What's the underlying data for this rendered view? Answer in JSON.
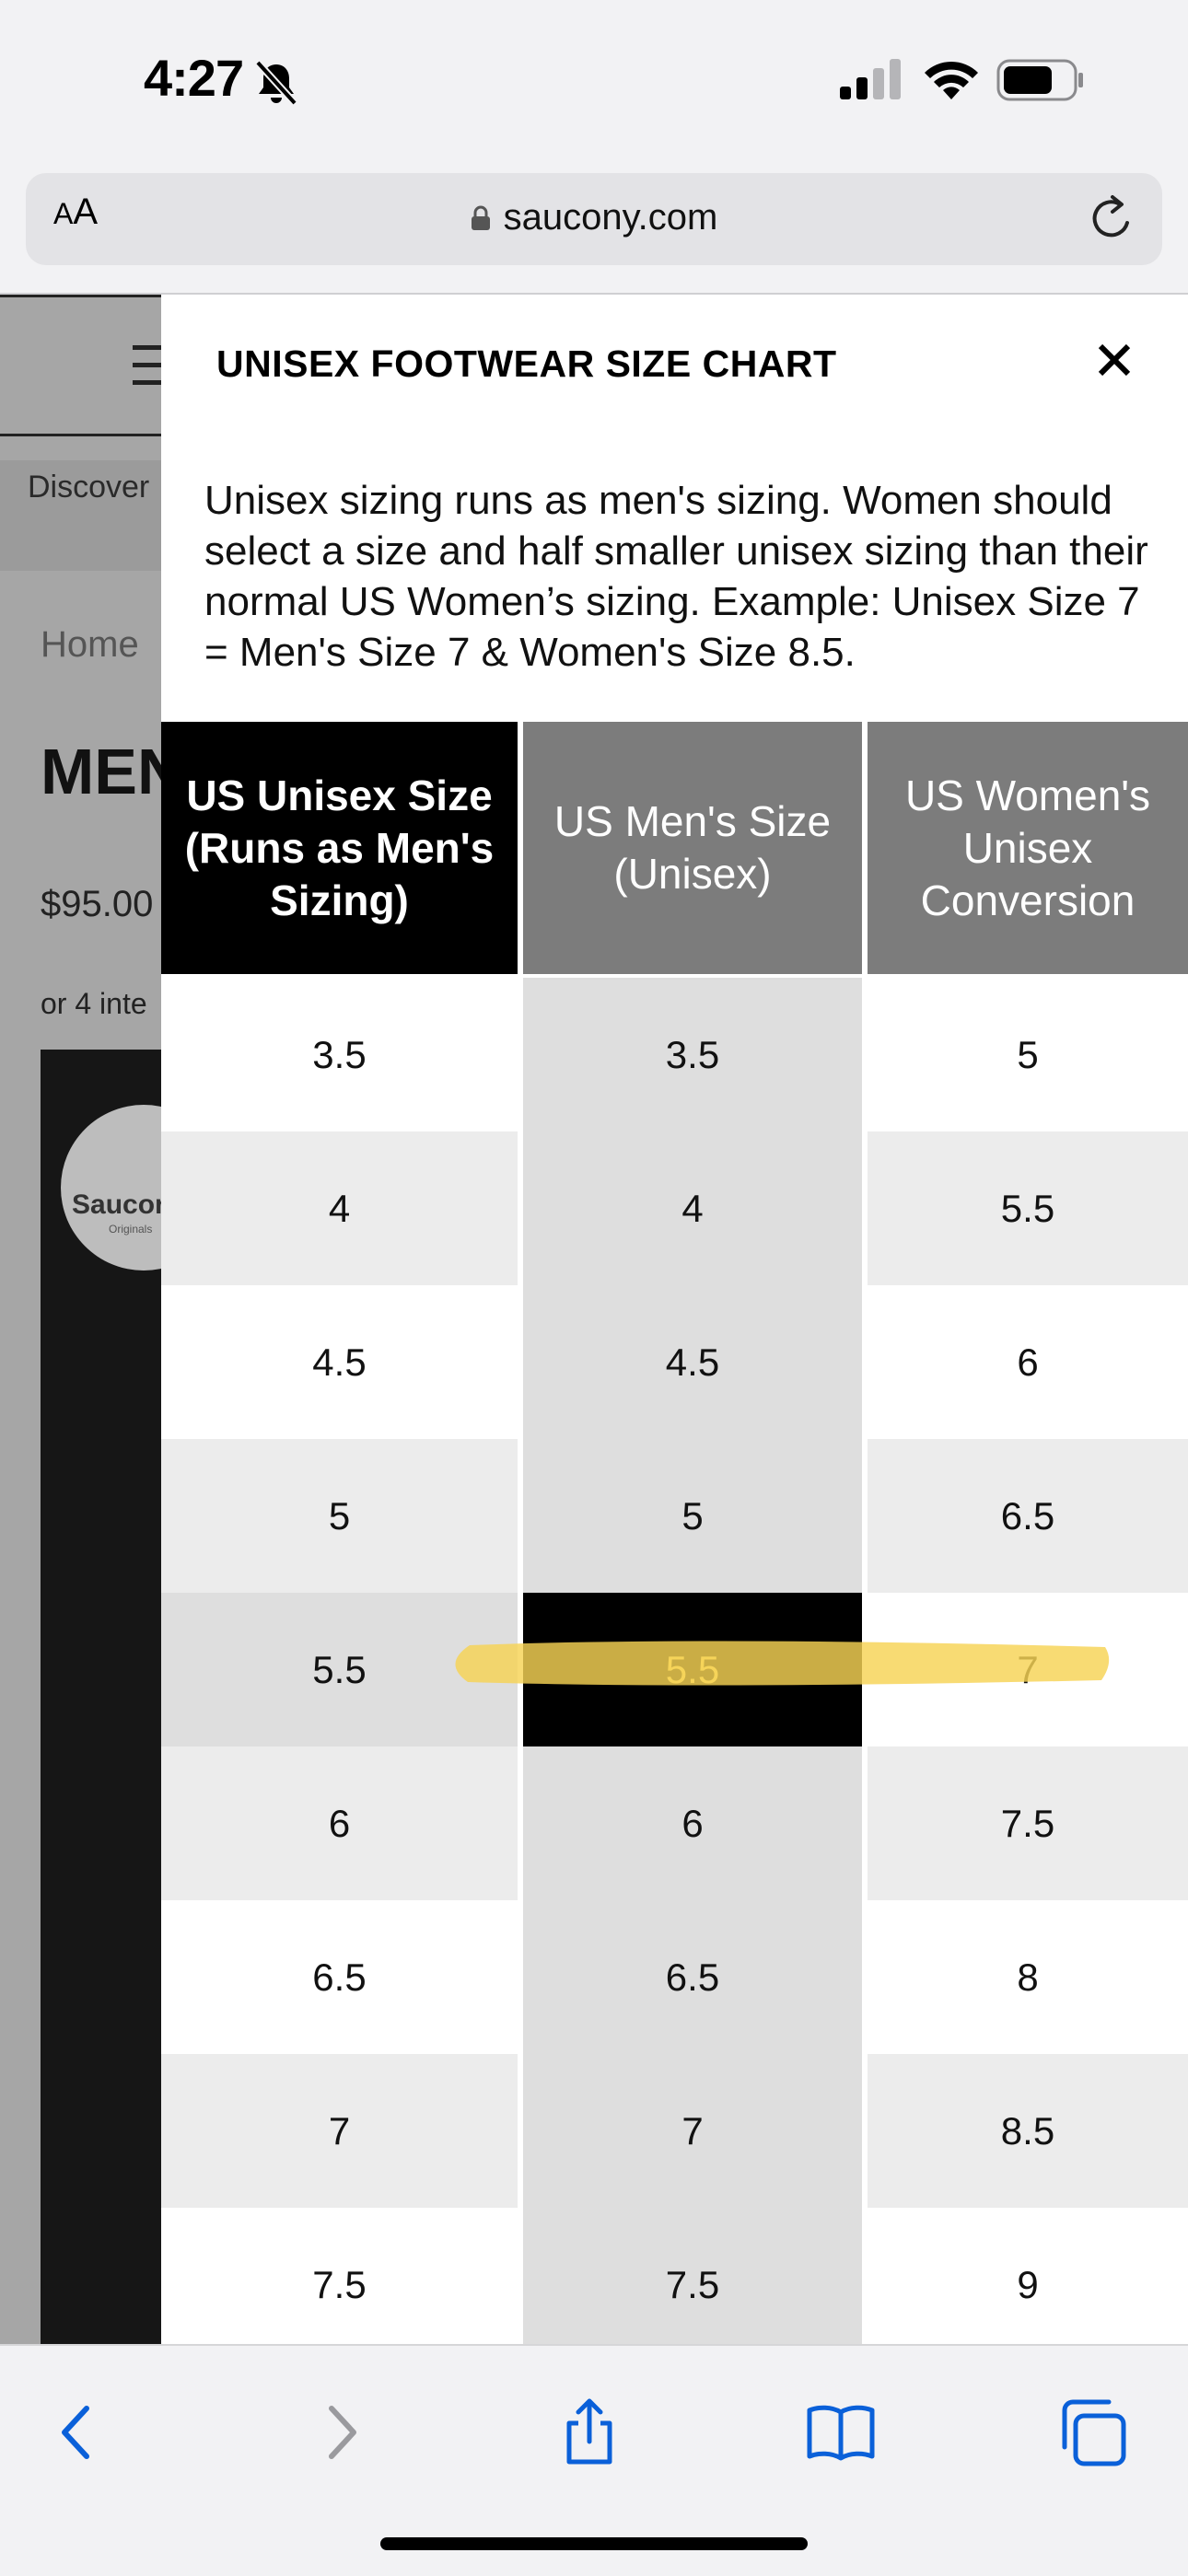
{
  "status_bar": {
    "time": "4:27",
    "icons": [
      "bell-slash-icon",
      "signal-icon",
      "wifi-icon",
      "battery-icon"
    ]
  },
  "browser": {
    "aa_label_small": "A",
    "aa_label_large": "A",
    "url": "saucony.com",
    "accent_color": "#0a60d9"
  },
  "background_page": {
    "discover": "Discover",
    "breadcrumb_home": "Home",
    "product_title_partial": "MEN",
    "price_partial": "$95.00",
    "installment_partial": "or 4 inte",
    "logo_text": "Saucor",
    "logo_subtext": "Originals"
  },
  "modal": {
    "title": "UNISEX FOOTWEAR SIZE CHART",
    "description": "Unisex sizing runs as men's sizing. Women should select a size and half smaller unisex sizing than their normal US Women’s sizing. Example: Unisex Size 7 = Men's Size 7 & Women's Size 8.5.",
    "table": {
      "headers": [
        "US Unisex Size (Runs as Men's Sizing)",
        "US Men's Size (Unisex)",
        "US Women's Unisex Conversion"
      ],
      "rows": [
        [
          "3.5",
          "3.5",
          "5"
        ],
        [
          "4",
          "4",
          "5.5"
        ],
        [
          "4.5",
          "4.5",
          "6"
        ],
        [
          "5",
          "5",
          "6.5"
        ],
        [
          "5.5",
          "5.5",
          "7"
        ],
        [
          "6",
          "6",
          "7.5"
        ],
        [
          "6.5",
          "6.5",
          "8"
        ],
        [
          "7",
          "7",
          "8.5"
        ],
        [
          "7.5",
          "7.5",
          "9"
        ]
      ],
      "selected_row_index": 4,
      "colors": {
        "header_primary": "#000000",
        "header_secondary": "#7c7c7c",
        "selected_cell": "#000000",
        "selected_text": "#f5d76e",
        "highlight_marker": "#f7d354"
      }
    }
  },
  "toolbar": {
    "icons": [
      "back-icon",
      "forward-icon",
      "share-icon",
      "bookmarks-icon",
      "tabs-icon"
    ]
  }
}
